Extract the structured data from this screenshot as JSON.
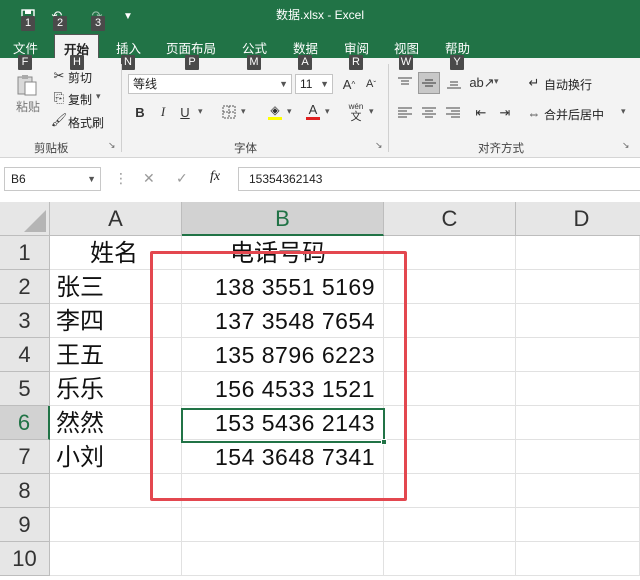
{
  "window": {
    "title": "数据.xlsx  -  Excel"
  },
  "quick_access": {
    "keytips": [
      "1",
      "2",
      "3"
    ]
  },
  "ribbon_tabs": {
    "file": "文件",
    "home": "开始",
    "insert": "插入",
    "page_layout": "页面布局",
    "formulas": "公式",
    "data": "数据",
    "review": "审阅",
    "view": "视图",
    "help": "帮助"
  },
  "tab_keytips": {
    "file": "F",
    "home": "H",
    "insert": "N",
    "page_layout": "P",
    "formulas": "M",
    "data": "A",
    "review": "R",
    "view": "W",
    "help": "Y"
  },
  "clipboard": {
    "paste": "粘贴",
    "cut": "剪切",
    "copy": "复制",
    "format_painter": "格式刷",
    "label": "剪贴板"
  },
  "font": {
    "name": "等线",
    "size": "11",
    "bold": "B",
    "italic": "I",
    "underline": "U",
    "label": "字体",
    "phonetic": "wén"
  },
  "alignment": {
    "wrap_text": "自动换行",
    "merge_center": "合并后居中",
    "label": "对齐方式"
  },
  "formula_bar": {
    "name_box": "B6",
    "cancel": "✕",
    "enter": "✓",
    "fx": "fx",
    "value": "15354362143"
  },
  "sheet": {
    "columns": [
      "A",
      "B",
      "C",
      "D"
    ],
    "selected_column": "B",
    "selected_row": "6",
    "rows": [
      {
        "num": "1",
        "a": "姓名",
        "b": "电话号码"
      },
      {
        "num": "2",
        "a": "张三",
        "b": "138 3551 5169"
      },
      {
        "num": "3",
        "a": "李四",
        "b": "137 3548 7654"
      },
      {
        "num": "4",
        "a": "王五",
        "b": "135 8796 6223"
      },
      {
        "num": "5",
        "a": "乐乐",
        "b": "156 4533 1521"
      },
      {
        "num": "6",
        "a": "然然",
        "b": "153 5436 2143"
      },
      {
        "num": "7",
        "a": "小刘",
        "b": "154 3648 7341"
      },
      {
        "num": "8",
        "a": "",
        "b": ""
      },
      {
        "num": "9",
        "a": "",
        "b": ""
      },
      {
        "num": "10",
        "a": "",
        "b": ""
      }
    ]
  },
  "colors": {
    "excel_green": "#217346",
    "highlight_box": "#e3474f"
  }
}
